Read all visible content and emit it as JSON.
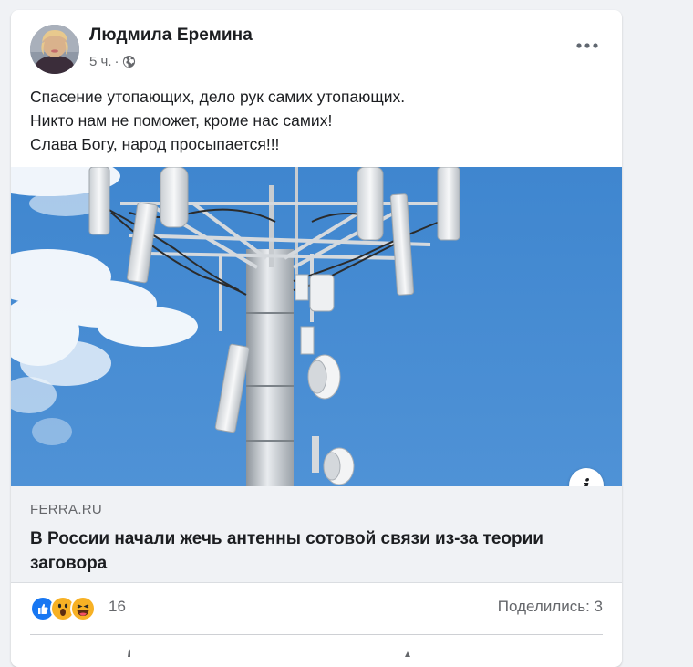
{
  "post": {
    "author": "Людмила Еремина",
    "time": "5 ч.",
    "separator": "·",
    "privacy_icon": "globe-icon",
    "text_lines": [
      "Спасение утопающих, дело рук самих утопающих.",
      "Никто нам не поможет, кроме нас самих!",
      "Слава Богу, народ просыпается!!!"
    ]
  },
  "link_preview": {
    "image_subject": "cell-tower-antennas",
    "info_label": "i",
    "domain": "FERRA.RU",
    "title": "В России начали жечь антенны сотовой связи из-за теории заговора"
  },
  "engagement": {
    "reactions": [
      "like",
      "wow",
      "haha"
    ],
    "reaction_count": "16",
    "shares": "Поделились: 3"
  },
  "colors": {
    "background": "#f0f2f5",
    "card": "#ffffff",
    "text": "#1c1e21",
    "secondary": "#65676b",
    "like": "#1877f2",
    "emoji": "#f7b125"
  }
}
